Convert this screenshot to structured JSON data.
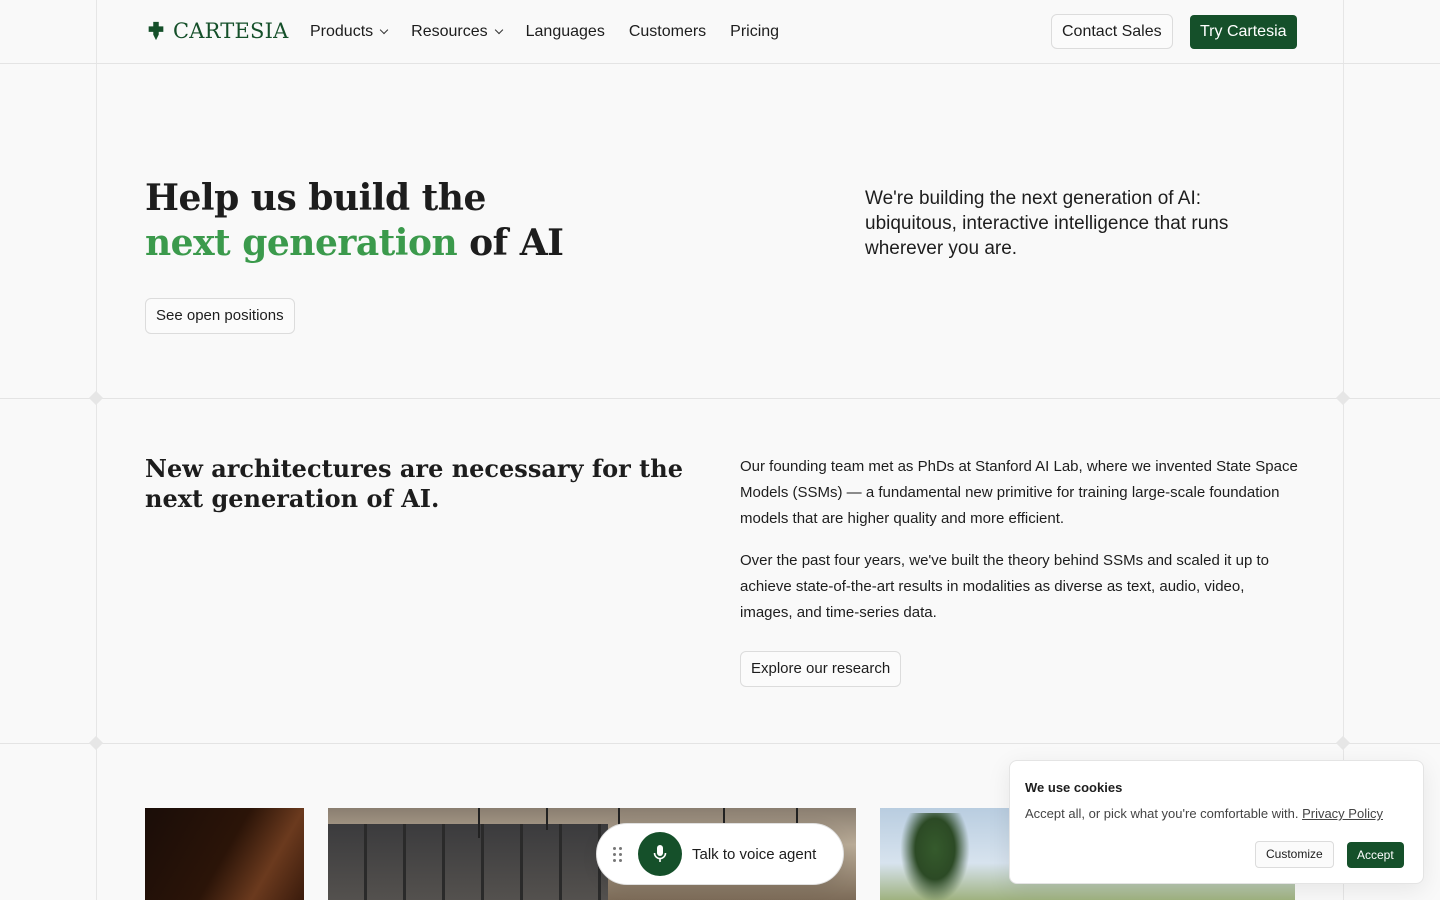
{
  "nav": {
    "logo_text": "CARTESIA",
    "links": [
      {
        "label": "Products",
        "has_dropdown": true
      },
      {
        "label": "Resources",
        "has_dropdown": true
      },
      {
        "label": "Languages",
        "has_dropdown": false
      },
      {
        "label": "Customers",
        "has_dropdown": false
      },
      {
        "label": "Pricing",
        "has_dropdown": false
      }
    ],
    "contact_label": "Contact Sales",
    "try_label": "Try Cartesia"
  },
  "hero": {
    "title_line1": "Help us build the",
    "title_accent": "next generation",
    "title_rest": " of AI",
    "cta_label": "See open positions",
    "subtitle": "We're building the next generation of AI: ubiquitous, interactive intelligence that runs wherever you are."
  },
  "research": {
    "title": "New architectures are necessary for the next generation of AI.",
    "para1": "Our founding team met as PhDs at Stanford AI Lab, where we invented State Space Models (SSMs) — a fundamental new primitive for training large-scale foundation models that are higher quality and more efficient.",
    "para2": "Over the past four years, we've built the theory behind SSMs and scaled it up to achieve state-of-the-art results in modalities as diverse as text, audio, video, images, and time-series data.",
    "cta_label": "Explore our research"
  },
  "voice": {
    "label": "Talk to voice agent",
    "icon": "microphone-icon"
  },
  "cookies": {
    "title": "We use cookies",
    "body": "Accept all, or pick what you're comfortable with.",
    "link_label": "Privacy Policy",
    "customize_label": "Customize",
    "accept_label": "Accept"
  },
  "colors": {
    "brand_green": "#15502a",
    "accent_green": "#3b9a4c",
    "background": "#f9f9f9"
  }
}
